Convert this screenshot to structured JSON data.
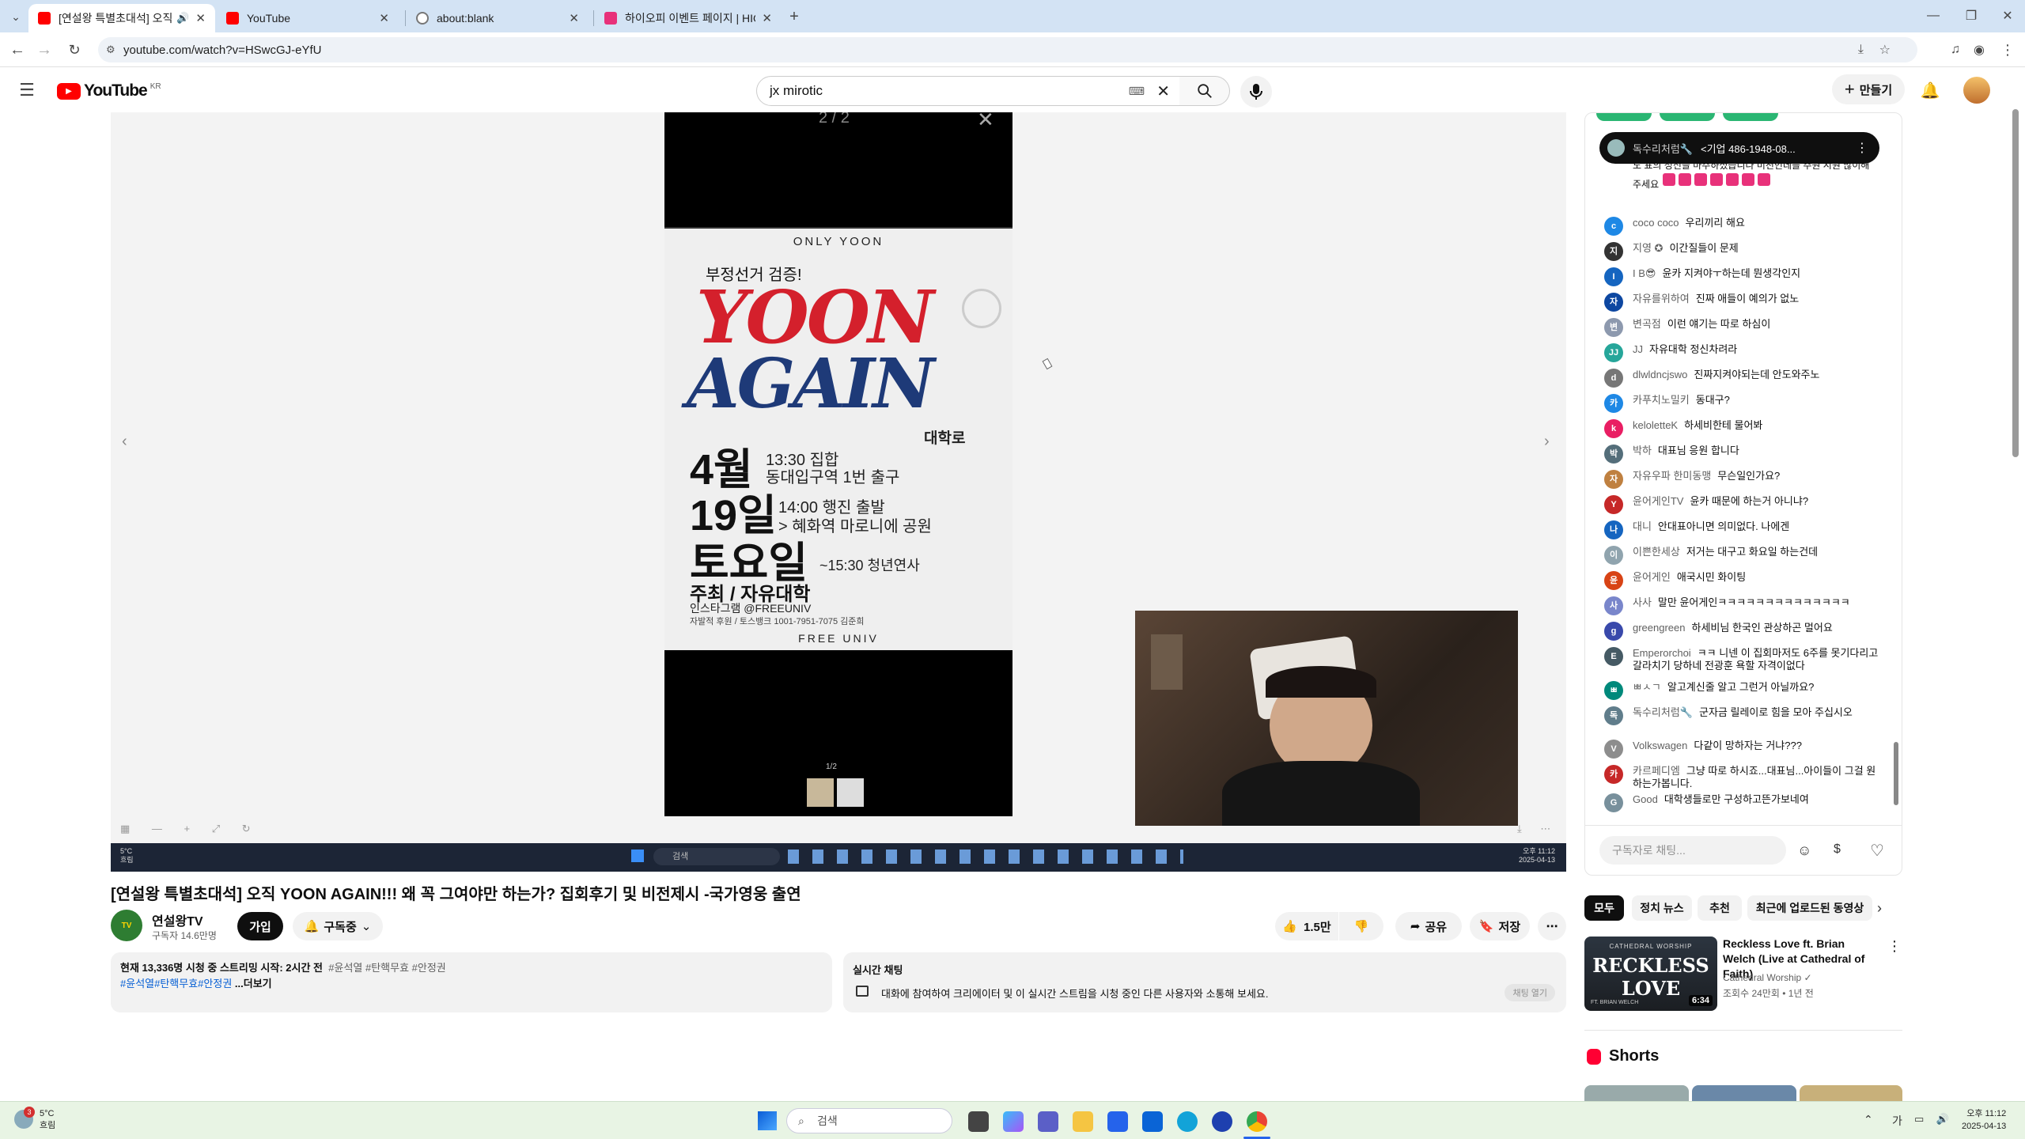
{
  "browser": {
    "tabs": [
      {
        "label": "[연설왕 특별초대석] 오직 Y",
        "active": true,
        "color": "#ff0000"
      },
      {
        "label": "YouTube",
        "active": false,
        "color": "#ff0000"
      },
      {
        "label": "about:blank",
        "active": false,
        "color": "#777777"
      },
      {
        "label": "하이오피 이벤트 페이지 | HIOP",
        "active": false,
        "color": "#e8317a"
      }
    ],
    "url": "youtube.com/watch?v=HSwcGJ-eYfU"
  },
  "youtube": {
    "logo": "YouTube",
    "region": "KR",
    "search": {
      "value": "jx mirotic"
    },
    "create_label": "만들기"
  },
  "player": {
    "counter": "2 / 2",
    "poster": {
      "top": "ONLY YOON",
      "sub": "부정선거 검증!",
      "big1": "YOON",
      "big2": "AGAIN",
      "place": "대학로",
      "month": "4월",
      "day": "19일",
      "dow": "토요일",
      "t1": "13:30 집합",
      "t1b": "동대입구역 1번 출구",
      "t2": "14:00 행진 출발",
      "t2b": "> 혜화역 마로니에 공원",
      "t3": "~15:30 청년연사",
      "host": "주최 / 자유대학",
      "insta": "인스타그램 @FREEUNIV",
      "bank": "자발적 후원 / 토스뱅크 1001-7951-7075 김준희",
      "bottom": "FREE UNIV"
    },
    "page_count": "1/2",
    "taskbar_temp": "5°C",
    "taskbar_cond": "흐림",
    "taskbar_search": "검색",
    "taskbar_time": "오후 11:12",
    "taskbar_date": "2025-04-13"
  },
  "video": {
    "title": "[연설왕 특별초대석] 오직 YOON AGAIN!!! 왜 꼭 그여야만 하는가? 집회후기 및 비전제시 -국가영웅 출연",
    "channel": "연설왕TV",
    "subs": "구독자 14.6만명",
    "join": "가입",
    "subscribed": "구독중",
    "likes": "1.5만",
    "share": "공유",
    "save": "저장",
    "desc_line1": "현재 13,336명 시청 중 스트리밍 시작: 2시간 전",
    "desc_tags1": "#윤석열 #탄핵무효 #안정권",
    "desc_tags2": "#윤석열#탄핵무효#안정권",
    "more": "...더보기"
  },
  "livechat_card": {
    "title": "실시간 채팅",
    "text": "대화에 참여하여 크리에이터 및 이 실시간 스트림을 시청 중인 다른 사용자와 소통해 보세요.",
    "button": "채팅 열기"
  },
  "chat": {
    "pinned_author": "독수리처럼🔧",
    "pinned_text": "<기업 486-1948-08...",
    "partial_text": "도 표의 정신을 마주하셨습니다 미천인데를 주원 시원 많이해주세요",
    "messages": [
      {
        "a": "coco coco",
        "t": "우리끼리 해요",
        "c": "#1e88e5",
        "i": "c"
      },
      {
        "a": "지영 ✪",
        "t": "이간질들이 문제",
        "c": "#333333",
        "i": "지"
      },
      {
        "a": "I B😎",
        "t": "윤카 지켜야ㅜ하는데 뭔생각인지",
        "c": "#1565c0",
        "i": "I"
      },
      {
        "a": "자유를위하여",
        "t": "진짜 애들이 예의가 없노",
        "c": "#0d47a1",
        "i": "자"
      },
      {
        "a": "변곡점",
        "t": "이런 얘기는 따로 하심이",
        "c": "#8d99ae",
        "i": "변"
      },
      {
        "a": "JJ",
        "t": "자유대학 정신차려라",
        "c": "#26a69a",
        "i": "JJ"
      },
      {
        "a": "dlwldncjswo",
        "t": "진짜지켜야되는데 안도와주노",
        "c": "#777777",
        "i": "d"
      },
      {
        "a": "카푸치노밀키",
        "t": "동대구?",
        "c": "#1e88e5",
        "i": "카"
      },
      {
        "a": "keloletteK",
        "t": "하세비한테 물어봐",
        "c": "#e91e63",
        "i": "k"
      },
      {
        "a": "박하",
        "t": "대표님 응원 합니다",
        "c": "#546e7a",
        "i": "박"
      },
      {
        "a": "자유우파 한미동맹",
        "t": "무슨일인가요?",
        "c": "#bf8040",
        "i": "자"
      },
      {
        "a": "윤어게인TV",
        "t": "윤카 때문에 하는거 아니냐?",
        "c": "#c62828",
        "i": "Y"
      },
      {
        "a": "대니",
        "t": "안대표아니면 의미없다. 나에겐",
        "c": "#1565c0",
        "i": "나"
      },
      {
        "a": "이쁜한세상",
        "t": "저거는 대구고 화요일 하는건데",
        "c": "#90a4ae",
        "i": "이"
      },
      {
        "a": "윤어게인",
        "t": "애국시민 화이팅",
        "c": "#d84315",
        "i": "윤"
      },
      {
        "a": "사사",
        "t": "말만 윤어게인ㅋㅋㅋㅋㅋㅋㅋㅋㅋㅋㅋㅋㅋㅋ",
        "c": "#7986cb",
        "i": "사"
      },
      {
        "a": "greengreen",
        "t": "하세비님 한국인 관상하곤 멀어요",
        "c": "#3949ab",
        "i": "g"
      },
      {
        "a": "Emperorchoi",
        "t": "ㅋㅋ 니넨 이 집회마저도 6주를 못기다리고 갈라치기 당하네 전광훈 욕할 자격이없다",
        "c": "#455a64",
        "i": "E"
      },
      {
        "a": "ㅃㅅㄱ",
        "t": "알고계신줄 알고 그런거 아닐까요?",
        "c": "#00897b",
        "i": "ㅃ"
      },
      {
        "a": "독수리처럼🔧",
        "t": "군자금 릴레이로 힘을 모아 주십시오",
        "c": "#607d8b",
        "i": "독"
      },
      {
        "a": "Volkswagen",
        "t": "다같이 망하자는 거냐???",
        "c": "#8d8d8d",
        "i": "V"
      },
      {
        "a": "카르페디엠",
        "t": "그냥 따로 하시죠...대표님...아이들이 그걸 원하는가봅니다.",
        "c": "#c62828",
        "i": "카"
      },
      {
        "a": "Good",
        "t": "대학생들로만 구성하고뜬가보네여",
        "c": "#78909c",
        "i": "G"
      }
    ],
    "input_placeholder": "구독자로 채팅..."
  },
  "sidebar": {
    "chips": [
      "모두",
      "정치 뉴스",
      "추천",
      "최근에 업로드된 동영상"
    ],
    "rec": {
      "title": "Reckless Love ft. Brian Welch (Live at Cathedral of Faith)",
      "channel": "Cathedral Worship",
      "meta": "조회수 24만회 • 1년 전",
      "duration": "6:34",
      "thumb_title": "RECKLESS LOVE",
      "thumb_top": "CATHEDRAL WORSHIP",
      "thumb_ft": "FT. BRIAN WELCH"
    },
    "shorts": "Shorts"
  },
  "os_taskbar": {
    "temp": "5°C",
    "cond": "흐림",
    "search": "검색",
    "badge": "3",
    "time": "오후 11:12",
    "date": "2025-04-13",
    "lang": "가"
  }
}
